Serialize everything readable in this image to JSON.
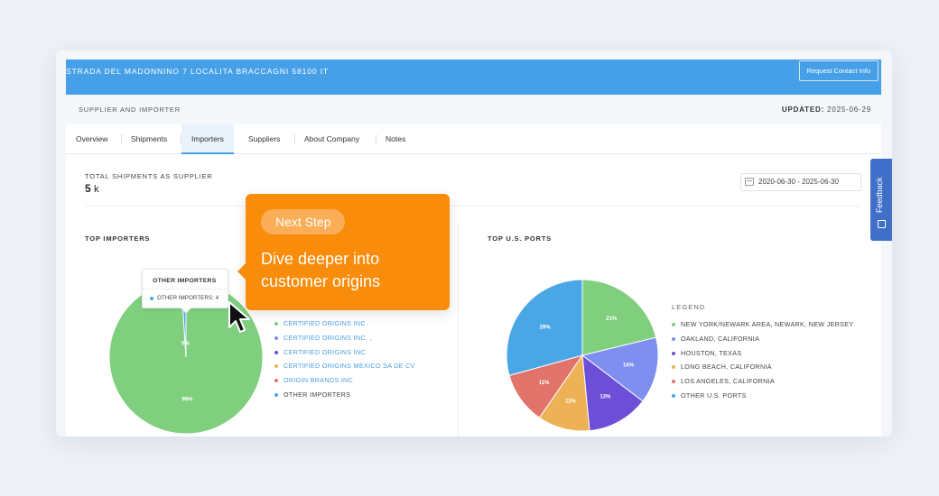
{
  "header": {
    "address": "STRADA DEL MADONNINO 7 LOCALITA BRACCAGNI 58100 IT",
    "request_button": "Request Contact Info"
  },
  "subheader": {
    "label": "SUPPLIER AND IMPORTER",
    "updated_label": "UPDATED:",
    "updated_date": "2025-06-29"
  },
  "tabs": [
    {
      "label": "Overview"
    },
    {
      "label": "Shipments"
    },
    {
      "label": "Importers",
      "active": true
    },
    {
      "label": "Suppliers"
    },
    {
      "label": "About Company"
    },
    {
      "label": "Notes"
    }
  ],
  "summary": {
    "label": "TOTAL SHIPMENTS AS SUPPLIER",
    "value": "5",
    "unit": "k"
  },
  "date_range": "2020-06-30 - 2025-06-30",
  "top_importers": {
    "title": "TOP IMPORTERS",
    "legend": [
      {
        "label": "CERTIFIED ORIGINS INC",
        "color": "#7fcf7f",
        "link": true
      },
      {
        "label": "CERTIFIED ORIGINS INC. ,",
        "color": "#7f8ff0",
        "link": true
      },
      {
        "label": "CERTIFIED ORIGINS INC.",
        "color": "#6c4fd6",
        "link": true
      },
      {
        "label": "CERTIFIED ORIGINS MEXICO SA DE CV",
        "color": "#edb256",
        "link": true
      },
      {
        "label": "ORIGIN BRANDS INC",
        "color": "#e2736a",
        "link": true
      },
      {
        "label": "OTHER IMPORTERS",
        "color": "#4aa7e6",
        "link": false
      }
    ]
  },
  "top_ports": {
    "title": "TOP U.S. PORTS",
    "legend_title": "LEGEND",
    "legend": [
      {
        "label": "NEW YORK/NEWARK AREA, NEWARK, NEW JERSEY",
        "color": "#7fcf7f"
      },
      {
        "label": "OAKLAND, CALIFORNIA",
        "color": "#7f8ff0"
      },
      {
        "label": "HOUSTON, TEXAS",
        "color": "#6c4fd6"
      },
      {
        "label": "LONG BEACH, CALIFORNIA",
        "color": "#edb256"
      },
      {
        "label": "LOS ANGELES, CALIFORNIA",
        "color": "#e2736a"
      },
      {
        "label": "OTHER U.S. PORTS",
        "color": "#4aa7e6"
      }
    ]
  },
  "tooltip": {
    "title": "OTHER IMPORTERS",
    "row": "OTHER IMPORTERS: 4",
    "color": "#4aa7e6"
  },
  "callout": {
    "pill": "Next Step",
    "body": "Dive deeper into customer origins"
  },
  "feedback": {
    "label": "Feedback"
  },
  "chart_data": [
    {
      "type": "pie",
      "title": "TOP IMPORTERS",
      "labels": [
        "CERTIFIED ORIGINS INC",
        "OTHER IMPORTERS"
      ],
      "values": [
        99,
        1
      ],
      "value_labels": [
        "99%",
        "0%"
      ],
      "colors": [
        "#7fcf7f",
        "#4aa7e6"
      ]
    },
    {
      "type": "pie",
      "title": "TOP U.S. PORTS",
      "labels": [
        "NEW YORK/NEWARK AREA, NEWARK, NEW JERSEY",
        "OAKLAND, CALIFORNIA",
        "HOUSTON, TEXAS",
        "LONG BEACH, CALIFORNIA",
        "LOS ANGELES, CALIFORNIA",
        "OTHER U.S. PORTS"
      ],
      "values": [
        21,
        14,
        13,
        11,
        11,
        29
      ],
      "value_labels": [
        "21%",
        "14%",
        "13%",
        "11%",
        "11%",
        "29%"
      ],
      "colors": [
        "#7fcf7f",
        "#7f8ff0",
        "#6c4fd6",
        "#edb256",
        "#e2736a",
        "#4aa7e6"
      ]
    }
  ]
}
